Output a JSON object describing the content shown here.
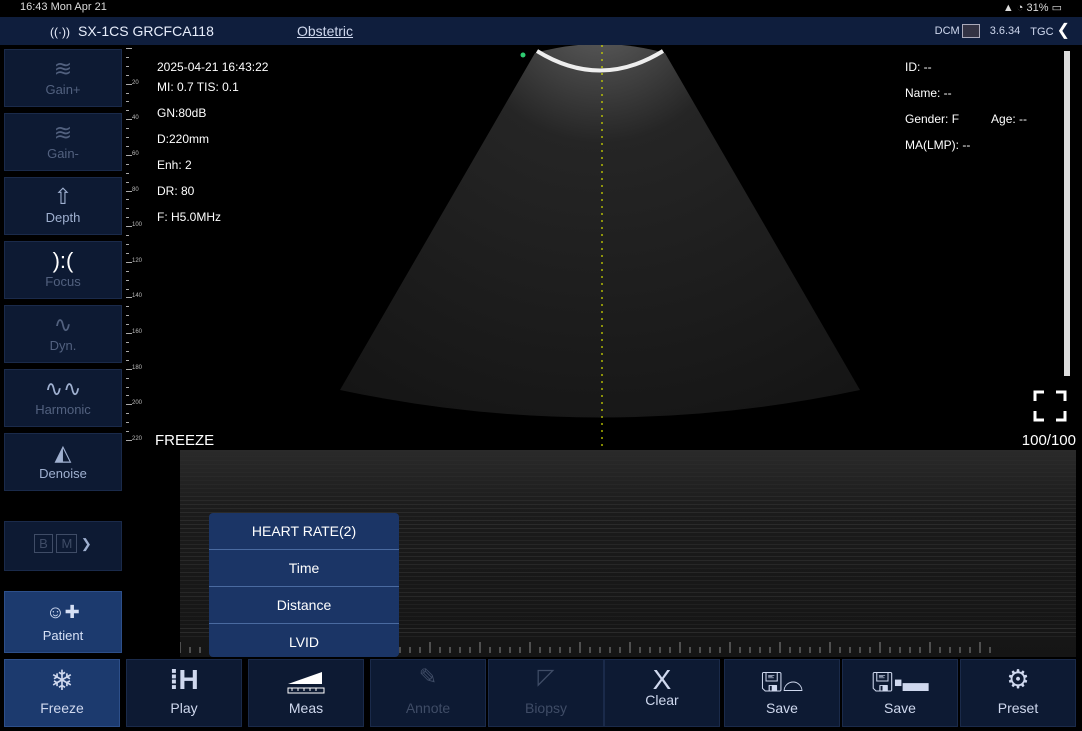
{
  "status_bar": {
    "time": "16:43  Mon Apr 21",
    "battery": "31%"
  },
  "header": {
    "probe_name": "SX-1CS GRCFCA118",
    "preset": "Obstetric",
    "dcm_label": "DCM",
    "version": "3.6.34",
    "tgc_label": "TGC"
  },
  "sidebar": {
    "gain_plus": "Gain+",
    "gain_minus": "Gain-",
    "depth": "Depth",
    "focus": "Focus",
    "dyn": "Dyn.",
    "harmonic": "Harmonic",
    "denoise": "Denoise",
    "mode_b": "B",
    "mode_m": "M",
    "patient": "Patient"
  },
  "depth_scale": [
    "20",
    "40",
    "60",
    "80",
    "100",
    "120",
    "140",
    "160",
    "180",
    "200",
    "220"
  ],
  "image_info": {
    "datetime": "2025-04-21 16:43:22",
    "mi_tis": "MI: 0.7  TIS: 0.1",
    "gain": "GN:80dB",
    "depth": "D:220mm",
    "enh": "Enh: 2",
    "dr": "DR: 80",
    "freq": "F: H5.0MHz"
  },
  "patient_info": {
    "id": "ID: --",
    "name": "Name: --",
    "gender": "Gender: F",
    "age": "Age: --",
    "ma": "MA(LMP): --"
  },
  "freeze_label": "FREEZE",
  "frame_counter": "100/100",
  "measure_menu": [
    "HEART RATE(2)",
    "Time",
    "Distance",
    "LVID"
  ],
  "bottom_bar": {
    "freeze": "Freeze",
    "play": "Play",
    "meas": "Meas",
    "annote": "Annote",
    "biopsy": "Biopsy",
    "clear": "Clear",
    "save_image": "Save",
    "save_cine": "Save",
    "preset": "Preset"
  },
  "colors": {
    "accent": "#1c3a6e",
    "panel": "#0d1a33",
    "centerline": "#c8d200"
  }
}
